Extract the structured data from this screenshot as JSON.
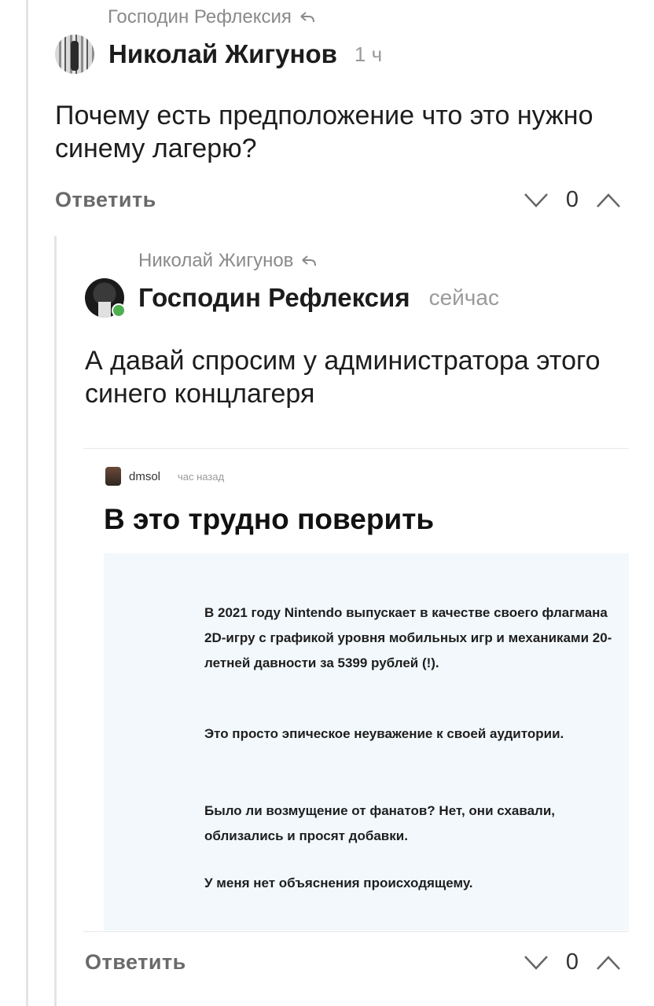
{
  "comment1": {
    "reply_to": "Господин Рефлексия",
    "author": "Николай Жигунов",
    "time": "1 ч",
    "text": "Почему есть предположение что это нужно синему лагерю?",
    "reply_label": "Ответить",
    "votes": "0"
  },
  "comment2": {
    "reply_to": "Николай Жигунов",
    "author": "Господин Рефлексия",
    "time": "сейчас",
    "text": "А давай спросим у администратора этого синего концлагеря",
    "reply_label": "Ответить",
    "votes": "0",
    "online_color": "#4caf50",
    "embed": {
      "author": "dmsol",
      "time": "час назад",
      "title": "В это трудно поверить",
      "background": "#f2f8fc",
      "paragraphs": [
        "В 2021 году Nintendo выпускает в качестве своего флагмана 2D-игру с графикой уровня мобильных игр и механиками 20-летней давности за 5399 рублей (!).",
        "Это просто эпическое неуважение к своей аудитории.",
        "Было ли возмущение от фанатов? Нет, они схавали, облизались и просят добавки.",
        "У меня нет объяснения происходящему."
      ]
    }
  }
}
